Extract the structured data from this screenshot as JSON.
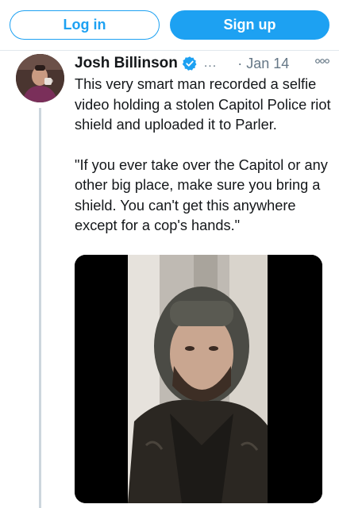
{
  "auth": {
    "login_label": "Log in",
    "signup_label": "Sign up"
  },
  "tweet": {
    "author_name": "Josh Billinson",
    "verified_icon": "verified-badge-icon",
    "handle_overflow": "...",
    "date": "· Jan 14",
    "more_icon": "more-options-icon",
    "paragraph_1": "This very smart man recorded a selfie video holding a stolen Capitol Police riot shield and uploaded it to Parler.",
    "paragraph_2": "\"If you ever take over the Capitol or any other big place, make sure you bring a shield. You can't get this anywhere except for a cop's hands.\""
  },
  "colors": {
    "accent": "#1da1f2",
    "text": "#14171a",
    "secondary": "#657786",
    "thread_line": "#ccd6dd"
  }
}
